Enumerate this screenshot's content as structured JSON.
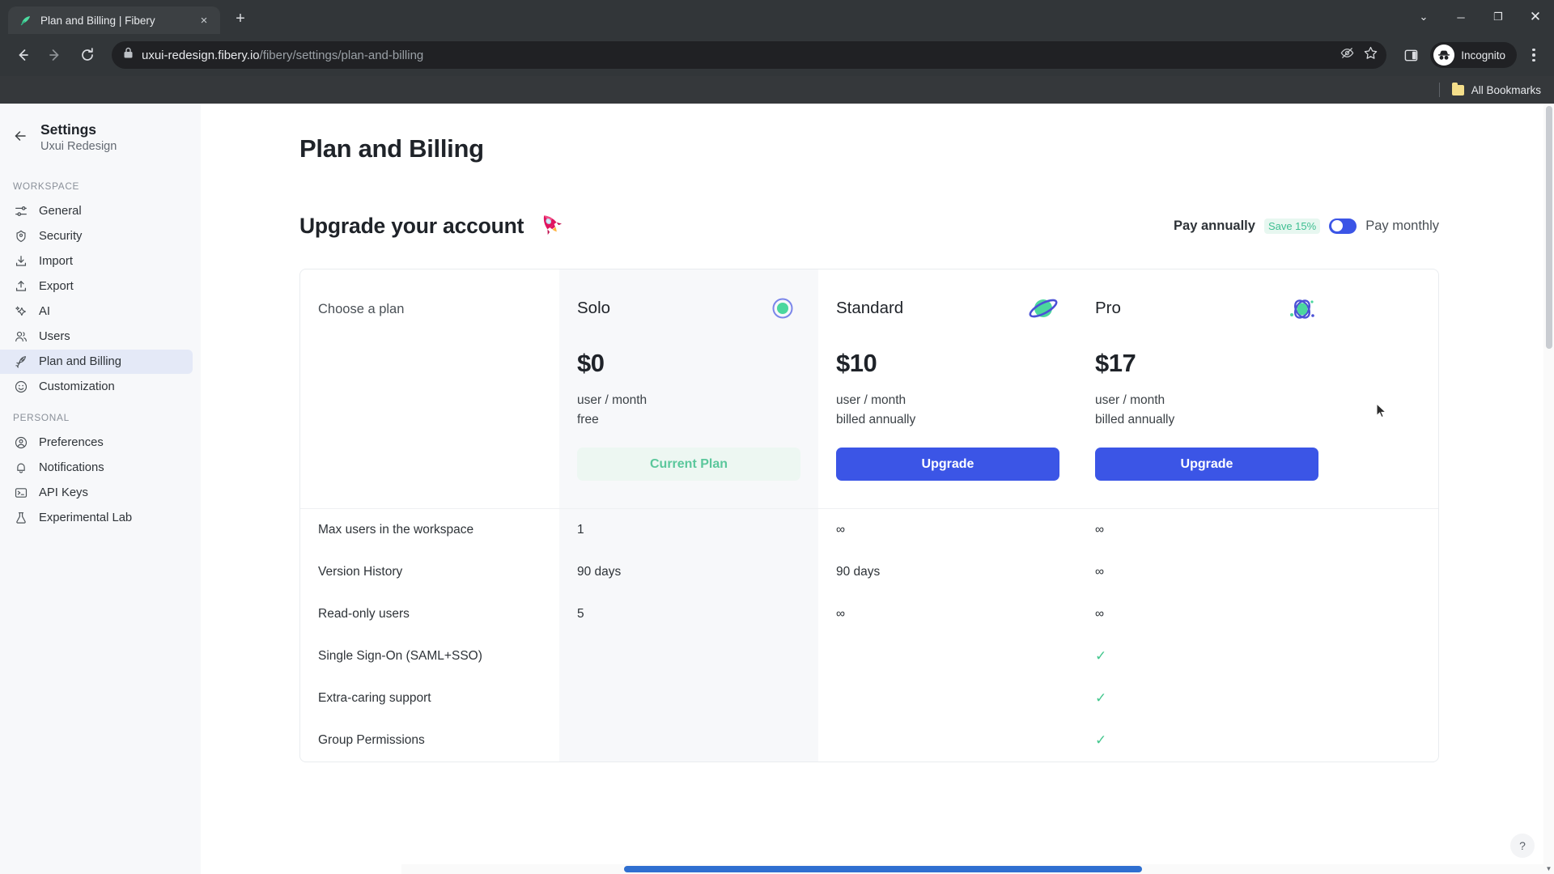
{
  "browser": {
    "tab": {
      "title": "Plan and Billing | Fibery",
      "close_label": "×",
      "favicon": "fibery-leaf-icon"
    },
    "new_tab_label": "+",
    "window_controls": {
      "minimize_all": "⌄",
      "minimize": "─",
      "maximize": "❐",
      "close": "✕"
    },
    "nav": {
      "back": "←",
      "forward": "→",
      "reload": "⟳"
    },
    "omnibox": {
      "lock": "lock-icon",
      "domain": "uxui-redesign.fibery.io",
      "path": "/fibery/settings/plan-and-billing"
    },
    "omni_actions": {
      "hide_password": "eye-off-icon",
      "bookmark": "star-icon"
    },
    "right": {
      "side_panel": "side-panel-icon",
      "profile_label": "Incognito",
      "menu": "kebab-menu-icon"
    },
    "bookmarks_bar": {
      "folder": "folder-icon",
      "label": "All Bookmarks"
    }
  },
  "sidebar": {
    "back": "back-arrow-icon",
    "title": "Settings",
    "subtitle": "Uxui Redesign",
    "groups": [
      {
        "label": "WORKSPACE",
        "items": [
          {
            "label": "General",
            "icon": "sliders-icon",
            "active": false
          },
          {
            "label": "Security",
            "icon": "shield-icon",
            "active": false
          },
          {
            "label": "Import",
            "icon": "download-icon",
            "active": false
          },
          {
            "label": "Export",
            "icon": "upload-icon",
            "active": false
          },
          {
            "label": "AI",
            "icon": "sparkle-icon",
            "active": false
          },
          {
            "label": "Users",
            "icon": "users-icon",
            "active": false
          },
          {
            "label": "Plan and Billing",
            "icon": "rocket-icon",
            "active": true
          },
          {
            "label": "Customization",
            "icon": "smiley-icon",
            "active": false
          }
        ]
      },
      {
        "label": "PERSONAL",
        "items": [
          {
            "label": "Preferences",
            "icon": "user-circle-icon",
            "active": false
          },
          {
            "label": "Notifications",
            "icon": "bell-icon",
            "active": false
          },
          {
            "label": "API Keys",
            "icon": "terminal-icon",
            "active": false
          },
          {
            "label": "Experimental Lab",
            "icon": "flask-icon",
            "active": false
          }
        ]
      }
    ]
  },
  "main": {
    "page_title": "Plan and Billing",
    "upgrade_heading": "Upgrade your account",
    "upgrade_emoji": "rocket-icon",
    "billing": {
      "annual_label": "Pay annually",
      "save_badge": "Save 15%",
      "monthly_label": "Pay monthly",
      "switch_state": "annual"
    },
    "choose_a_plan": "Choose a plan",
    "plans": [
      {
        "name": "Solo",
        "badge": "radio-selected-icon",
        "price": "$0",
        "term_line_1": "user / month",
        "term_line_2": "free",
        "cta": "Current Plan",
        "cta_kind": "current",
        "highlight": true
      },
      {
        "name": "Standard",
        "badge": "planet-icon",
        "price": "$10",
        "term_line_1": "user / month",
        "term_line_2": "billed annually",
        "cta": "Upgrade",
        "cta_kind": "upgrade",
        "highlight": false
      },
      {
        "name": "Pro",
        "badge": "atom-icon",
        "price": "$17",
        "term_line_1": "user / month",
        "term_line_2": "billed annually",
        "cta": "Upgrade",
        "cta_kind": "upgrade",
        "highlight": false
      }
    ],
    "features": [
      {
        "label": "Max users in the workspace",
        "solo": "1",
        "standard": "∞",
        "pro": "∞"
      },
      {
        "label": "Version History",
        "solo": "90 days",
        "standard": "90 days",
        "pro": "∞"
      },
      {
        "label": "Read-only users",
        "solo": "5",
        "standard": "∞",
        "pro": "∞"
      },
      {
        "label": "Single Sign-On (SAML+SSO)",
        "solo": "",
        "standard": "",
        "pro": "✓"
      },
      {
        "label": "Extra-caring support",
        "solo": "",
        "standard": "",
        "pro": "✓"
      },
      {
        "label": "Group Permissions",
        "solo": "",
        "standard": "",
        "pro": "✓"
      }
    ],
    "help_label": "?"
  },
  "colors": {
    "accent_blue": "#3b55e6",
    "green": "#44c78e",
    "sidebar_active": "#e4e9f7",
    "badge_teal_text": "#3fbf92",
    "badge_teal_bg": "#e7f7f0"
  }
}
